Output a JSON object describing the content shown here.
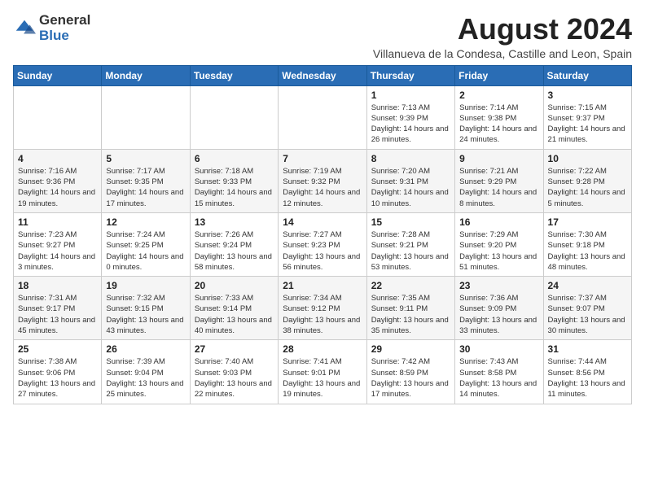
{
  "logo": {
    "general": "General",
    "blue": "Blue"
  },
  "title": {
    "month_year": "August 2024",
    "subtitle": "Villanueva de la Condesa, Castille and Leon, Spain"
  },
  "days_of_week": [
    "Sunday",
    "Monday",
    "Tuesday",
    "Wednesday",
    "Thursday",
    "Friday",
    "Saturday"
  ],
  "weeks": [
    [
      {
        "day": "",
        "info": ""
      },
      {
        "day": "",
        "info": ""
      },
      {
        "day": "",
        "info": ""
      },
      {
        "day": "",
        "info": ""
      },
      {
        "day": "1",
        "info": "Sunrise: 7:13 AM\nSunset: 9:39 PM\nDaylight: 14 hours and 26 minutes."
      },
      {
        "day": "2",
        "info": "Sunrise: 7:14 AM\nSunset: 9:38 PM\nDaylight: 14 hours and 24 minutes."
      },
      {
        "day": "3",
        "info": "Sunrise: 7:15 AM\nSunset: 9:37 PM\nDaylight: 14 hours and 21 minutes."
      }
    ],
    [
      {
        "day": "4",
        "info": "Sunrise: 7:16 AM\nSunset: 9:36 PM\nDaylight: 14 hours and 19 minutes."
      },
      {
        "day": "5",
        "info": "Sunrise: 7:17 AM\nSunset: 9:35 PM\nDaylight: 14 hours and 17 minutes."
      },
      {
        "day": "6",
        "info": "Sunrise: 7:18 AM\nSunset: 9:33 PM\nDaylight: 14 hours and 15 minutes."
      },
      {
        "day": "7",
        "info": "Sunrise: 7:19 AM\nSunset: 9:32 PM\nDaylight: 14 hours and 12 minutes."
      },
      {
        "day": "8",
        "info": "Sunrise: 7:20 AM\nSunset: 9:31 PM\nDaylight: 14 hours and 10 minutes."
      },
      {
        "day": "9",
        "info": "Sunrise: 7:21 AM\nSunset: 9:29 PM\nDaylight: 14 hours and 8 minutes."
      },
      {
        "day": "10",
        "info": "Sunrise: 7:22 AM\nSunset: 9:28 PM\nDaylight: 14 hours and 5 minutes."
      }
    ],
    [
      {
        "day": "11",
        "info": "Sunrise: 7:23 AM\nSunset: 9:27 PM\nDaylight: 14 hours and 3 minutes."
      },
      {
        "day": "12",
        "info": "Sunrise: 7:24 AM\nSunset: 9:25 PM\nDaylight: 14 hours and 0 minutes."
      },
      {
        "day": "13",
        "info": "Sunrise: 7:26 AM\nSunset: 9:24 PM\nDaylight: 13 hours and 58 minutes."
      },
      {
        "day": "14",
        "info": "Sunrise: 7:27 AM\nSunset: 9:23 PM\nDaylight: 13 hours and 56 minutes."
      },
      {
        "day": "15",
        "info": "Sunrise: 7:28 AM\nSunset: 9:21 PM\nDaylight: 13 hours and 53 minutes."
      },
      {
        "day": "16",
        "info": "Sunrise: 7:29 AM\nSunset: 9:20 PM\nDaylight: 13 hours and 51 minutes."
      },
      {
        "day": "17",
        "info": "Sunrise: 7:30 AM\nSunset: 9:18 PM\nDaylight: 13 hours and 48 minutes."
      }
    ],
    [
      {
        "day": "18",
        "info": "Sunrise: 7:31 AM\nSunset: 9:17 PM\nDaylight: 13 hours and 45 minutes."
      },
      {
        "day": "19",
        "info": "Sunrise: 7:32 AM\nSunset: 9:15 PM\nDaylight: 13 hours and 43 minutes."
      },
      {
        "day": "20",
        "info": "Sunrise: 7:33 AM\nSunset: 9:14 PM\nDaylight: 13 hours and 40 minutes."
      },
      {
        "day": "21",
        "info": "Sunrise: 7:34 AM\nSunset: 9:12 PM\nDaylight: 13 hours and 38 minutes."
      },
      {
        "day": "22",
        "info": "Sunrise: 7:35 AM\nSunset: 9:11 PM\nDaylight: 13 hours and 35 minutes."
      },
      {
        "day": "23",
        "info": "Sunrise: 7:36 AM\nSunset: 9:09 PM\nDaylight: 13 hours and 33 minutes."
      },
      {
        "day": "24",
        "info": "Sunrise: 7:37 AM\nSunset: 9:07 PM\nDaylight: 13 hours and 30 minutes."
      }
    ],
    [
      {
        "day": "25",
        "info": "Sunrise: 7:38 AM\nSunset: 9:06 PM\nDaylight: 13 hours and 27 minutes."
      },
      {
        "day": "26",
        "info": "Sunrise: 7:39 AM\nSunset: 9:04 PM\nDaylight: 13 hours and 25 minutes."
      },
      {
        "day": "27",
        "info": "Sunrise: 7:40 AM\nSunset: 9:03 PM\nDaylight: 13 hours and 22 minutes."
      },
      {
        "day": "28",
        "info": "Sunrise: 7:41 AM\nSunset: 9:01 PM\nDaylight: 13 hours and 19 minutes."
      },
      {
        "day": "29",
        "info": "Sunrise: 7:42 AM\nSunset: 8:59 PM\nDaylight: 13 hours and 17 minutes."
      },
      {
        "day": "30",
        "info": "Sunrise: 7:43 AM\nSunset: 8:58 PM\nDaylight: 13 hours and 14 minutes."
      },
      {
        "day": "31",
        "info": "Sunrise: 7:44 AM\nSunset: 8:56 PM\nDaylight: 13 hours and 11 minutes."
      }
    ]
  ]
}
